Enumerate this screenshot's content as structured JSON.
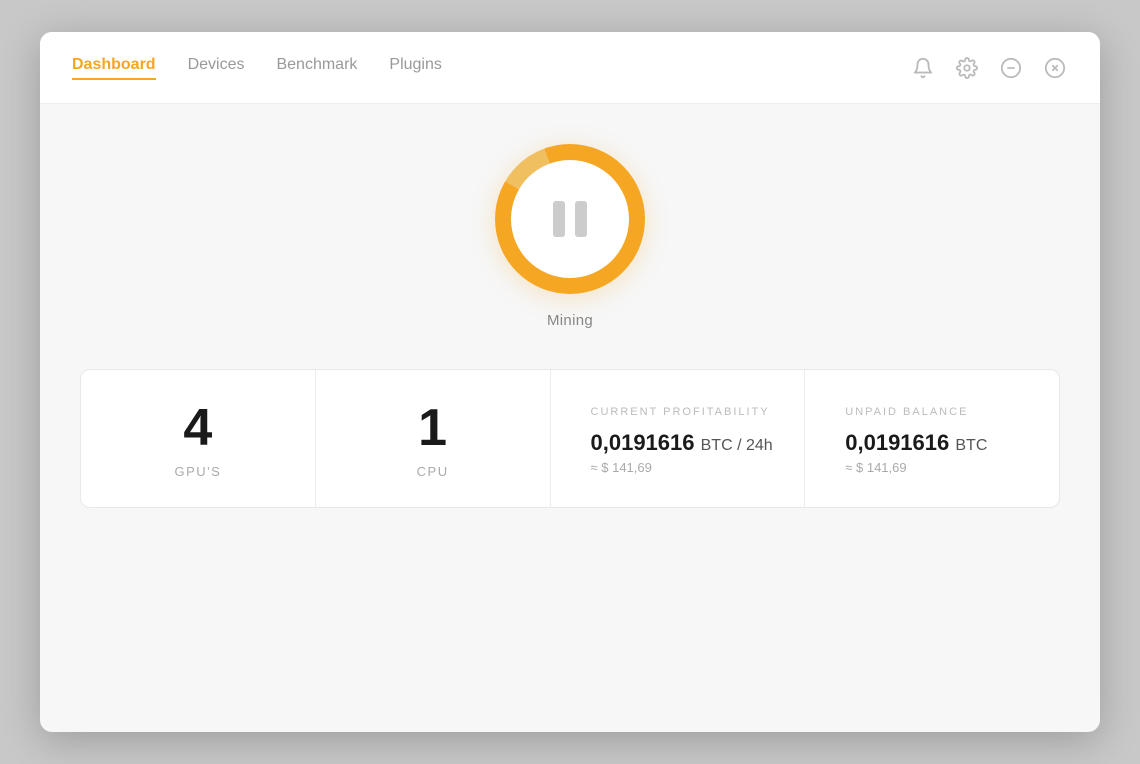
{
  "nav": {
    "items": [
      {
        "id": "dashboard",
        "label": "Dashboard",
        "active": true
      },
      {
        "id": "devices",
        "label": "Devices",
        "active": false
      },
      {
        "id": "benchmark",
        "label": "Benchmark",
        "active": false
      },
      {
        "id": "plugins",
        "label": "Plugins",
        "active": false
      }
    ]
  },
  "header_icons": {
    "bell": "🔔",
    "settings": "⚙",
    "minus": "⊖",
    "close": "⊗"
  },
  "mining": {
    "status_label": "Mining"
  },
  "stats": {
    "gpu_count": "4",
    "gpu_label": "GPU'S",
    "cpu_count": "1",
    "cpu_label": "CPU",
    "profitability": {
      "section_label": "CURRENT PROFITABILITY",
      "btc_value": "0,0191616",
      "btc_unit": "BTC / 24h",
      "usd_approx": "≈ $ 141,69"
    },
    "balance": {
      "section_label": "UNPAID BALANCE",
      "btc_value": "0,0191616",
      "btc_unit": "BTC",
      "usd_approx": "≈ $ 141,69"
    }
  },
  "colors": {
    "accent": "#f5a623",
    "active_nav": "#f5a623"
  }
}
